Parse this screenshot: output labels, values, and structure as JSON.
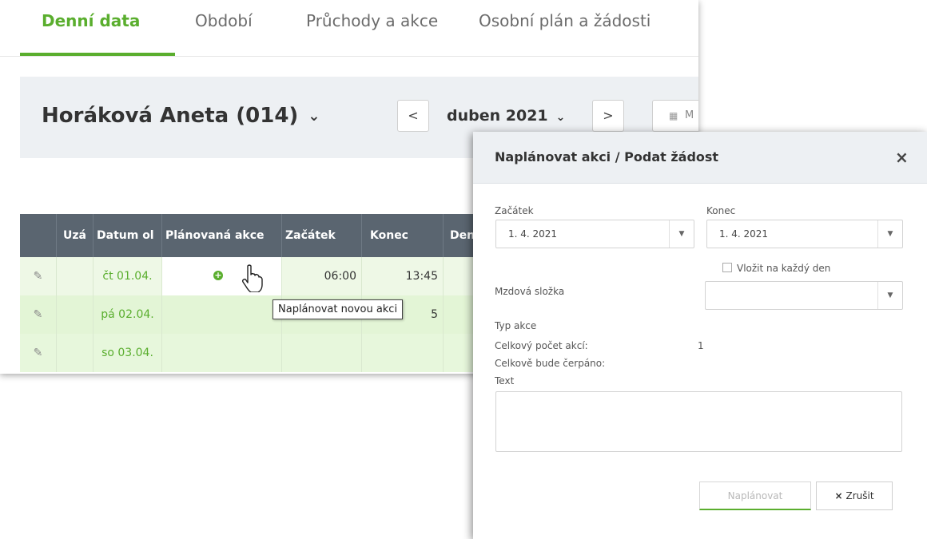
{
  "tabs": [
    {
      "label": "Denní data"
    },
    {
      "label": "Období"
    },
    {
      "label": "Průchody a akce"
    },
    {
      "label": "Osobní plán a žádosti"
    }
  ],
  "header": {
    "person": "Horáková Aneta (014)",
    "prev": "<",
    "month": "duben 2021",
    "next": ">",
    "calendar_btn": "M"
  },
  "table": {
    "columns": [
      "",
      "Uzá",
      "Datum ol",
      "Plánovaná akce",
      "Začátek",
      "Konec",
      "Den"
    ],
    "rows": [
      {
        "date": "čt 01.04.",
        "start": "06:00",
        "end": "13:45"
      },
      {
        "date": "pá 02.04.",
        "start": "",
        "end": "5"
      },
      {
        "date": "so 03.04.",
        "start": "",
        "end": ""
      }
    ]
  },
  "tooltip": "Naplánovat novou akci",
  "modal": {
    "title": "Naplánovat akci / Podat žádost",
    "close": "×",
    "start_label": "Začátek",
    "start_value": "1. 4. 2021",
    "end_label": "Konec",
    "end_value": "1. 4. 2021",
    "every_day_label": "Vložit na každý den",
    "wage_label": "Mzdová složka",
    "wage_value": "",
    "action_type_label": "Typ akce",
    "total_label": "Celkový počet akcí:",
    "total_value": "1",
    "draw_label": "Celkově bude čerpáno:",
    "text_label": "Text",
    "plan_button": "Naplánovat",
    "cancel_button": "Zrušit",
    "cancel_icon": "×"
  },
  "colors": {
    "accent": "#5aae2e",
    "table_header": "#5a6570",
    "row_green": "#e7f7dc",
    "band": "#edf0f3"
  }
}
